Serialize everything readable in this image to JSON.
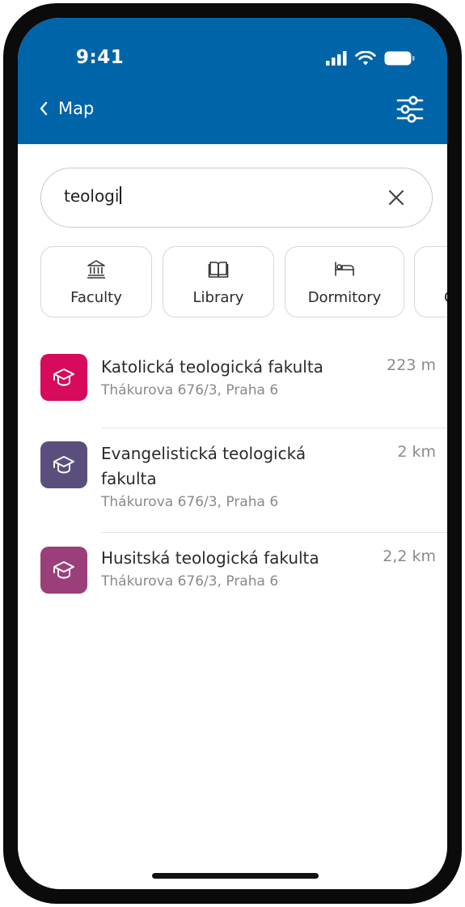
{
  "status_bar": {
    "time": "9:41"
  },
  "header": {
    "back_label": "Map",
    "accent": "#0064a8"
  },
  "search": {
    "value": "teologi"
  },
  "categories": [
    {
      "label": "Faculty",
      "icon": "bank-icon"
    },
    {
      "label": "Library",
      "icon": "book-icon"
    },
    {
      "label": "Dormitory",
      "icon": "bed-icon"
    },
    {
      "label": "Ca",
      "icon": "unknown-icon"
    }
  ],
  "results": [
    {
      "title": "Katolická teologická fakulta",
      "address": "Thákurova 676/3, Praha 6",
      "distance": "223 m",
      "color": "#d70a5b",
      "icon": "graduation-cap-icon"
    },
    {
      "title": "Evangelistická teologická fakulta",
      "address": "Thákurova 676/3, Praha 6",
      "distance": "2 km",
      "color": "#5a4f7c",
      "icon": "graduation-cap-icon"
    },
    {
      "title": "Husitská teologická fakulta",
      "address": "Thákurova 676/3, Praha 6",
      "distance": "2,2 km",
      "color": "#9b3f7a",
      "icon": "graduation-cap-icon"
    }
  ]
}
